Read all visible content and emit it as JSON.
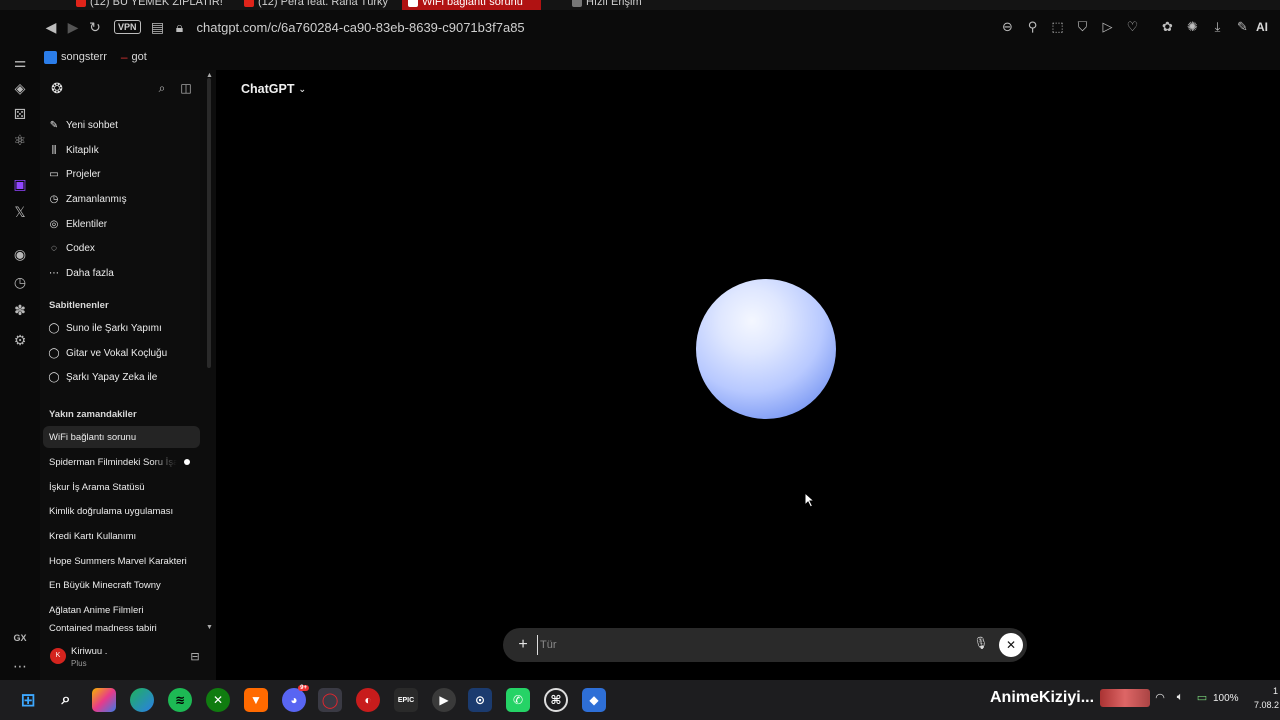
{
  "browser": {
    "tabs": [
      {
        "label": "(12) BU YEMEK ZIPLATIR!",
        "active": false
      },
      {
        "label": "(12) Pera feat. Rana Türky",
        "active": false
      },
      {
        "label": "WiFi bağlantı sorunu",
        "active": true
      },
      {
        "label": "Hızlı Erişim",
        "active": false
      }
    ],
    "vpn_label": "VPN",
    "url": "chatgpt.com/c/6a760284-ca90-83eb-8639-c9071b3f7a85",
    "ai_label": "AI",
    "bookmarks": [
      {
        "label": "songsterr",
        "icon": "songsterr-icon"
      },
      {
        "label": "got",
        "icon": "dash-icon"
      }
    ],
    "side_panel_label": "GX"
  },
  "sidebar": {
    "menu": [
      {
        "label": "Yeni sohbet",
        "icon": "edit-icon"
      },
      {
        "label": "Kitaplık",
        "icon": "library-icon"
      },
      {
        "label": "Projeler",
        "icon": "folder-icon"
      },
      {
        "label": "Zamanlanmış",
        "icon": "clock-icon"
      },
      {
        "label": "Eklentiler",
        "icon": "apps-icon"
      },
      {
        "label": "Codex",
        "icon": "codex-icon"
      },
      {
        "label": "Daha fazla",
        "icon": "more-icon"
      }
    ],
    "pinned_header": "Sabitlenenler",
    "pinned": [
      {
        "label": "Suno ile Şarkı Yapımı"
      },
      {
        "label": "Gitar ve Vokal Koçluğu"
      },
      {
        "label": "Şarkı Yapay Zeka ile"
      }
    ],
    "recent_header": "Yakın zamandakiler",
    "recent": [
      {
        "label": "WiFi bağlantı sorunu",
        "active": true,
        "unread": false
      },
      {
        "label": "Spiderman Filmindeki Soru İşareti",
        "active": false,
        "unread": true
      },
      {
        "label": "İşkur İş Arama Statüsü",
        "active": false,
        "unread": false
      },
      {
        "label": "Kimlik doğrulama uygulaması",
        "active": false,
        "unread": false
      },
      {
        "label": "Kredi Kartı Kullanımı",
        "active": false,
        "unread": false
      },
      {
        "label": "Hope Summers Marvel Karakteri",
        "active": false,
        "unread": false
      },
      {
        "label": "En Büyük Minecraft Towny",
        "active": false,
        "unread": false
      },
      {
        "label": "Ağlatan Anime Filmleri",
        "active": false,
        "unread": false
      },
      {
        "label": "Contained madness tabiri",
        "active": false,
        "unread": false
      }
    ],
    "user": {
      "name": "Kiriwuu .",
      "plan": "Plus"
    }
  },
  "main": {
    "model_selector": "ChatGPT",
    "composer": {
      "placeholder": "Tür",
      "value": ""
    }
  },
  "taskbar": {
    "tray_label": "AnimeKiziyi...",
    "battery": "100%",
    "time": "1",
    "date": "7.08.2"
  },
  "colors": {
    "accent_tab": "#b01212",
    "orb_light": "#f4f7ff",
    "orb_dark": "#6b88ec",
    "avatar": "#d4241e"
  }
}
